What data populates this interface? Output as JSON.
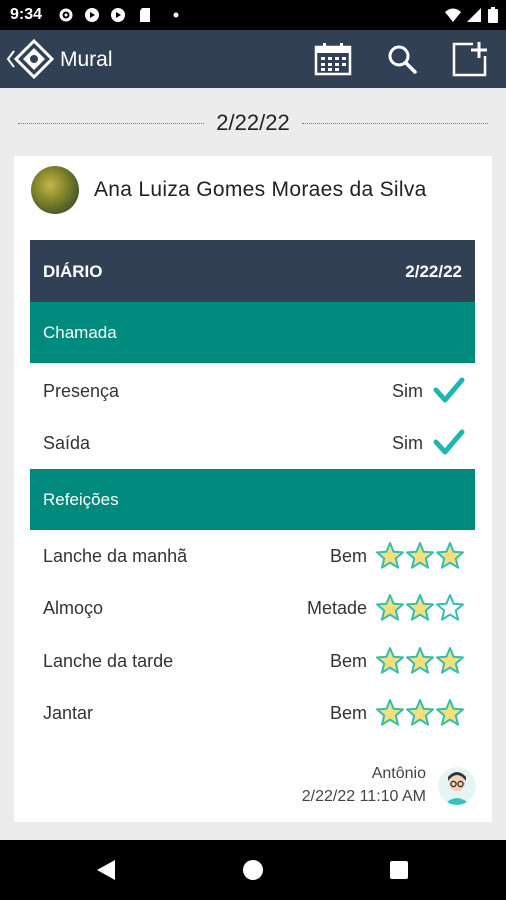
{
  "status_bar": {
    "time": "9:34"
  },
  "app_bar": {
    "title": "Mural"
  },
  "date_separator": "2/22/22",
  "post": {
    "author": "Ana Luiza Gomes Moraes da Silva",
    "diary": {
      "header_label": "DIÁRIO",
      "header_date": "2/22/22",
      "sections": [
        {
          "title": "Chamada",
          "rows": [
            {
              "label": "Presença",
              "value": "Sim"
            },
            {
              "label": "Saída",
              "value": "Sim"
            }
          ]
        },
        {
          "title": "Refeições",
          "rows": [
            {
              "label": "Lanche da manhã",
              "value": "Bem",
              "stars": 3
            },
            {
              "label": "Almoço",
              "value": "Metade",
              "stars": 2
            },
            {
              "label": "Lanche da tarde",
              "value": "Bem",
              "stars": 3
            },
            {
              "label": "Jantar",
              "value": "Bem",
              "stars": 3
            }
          ]
        }
      ]
    },
    "footer": {
      "author": "Antônio",
      "timestamp": "2/22/22 11:10 AM"
    }
  },
  "icons": {
    "back": "chevron-left-icon",
    "logo": "diamond-logo-icon",
    "calendar": "calendar-icon",
    "search": "search-icon",
    "new_post": "new-post-icon",
    "check": "check-icon",
    "star": "star-icon"
  },
  "colors": {
    "app_bar": "#324055",
    "section": "#008a7e",
    "check": "#1fb5b0",
    "star_fill": "#f3e07a",
    "star_stroke": "#34bdb4"
  },
  "max_stars": 3
}
